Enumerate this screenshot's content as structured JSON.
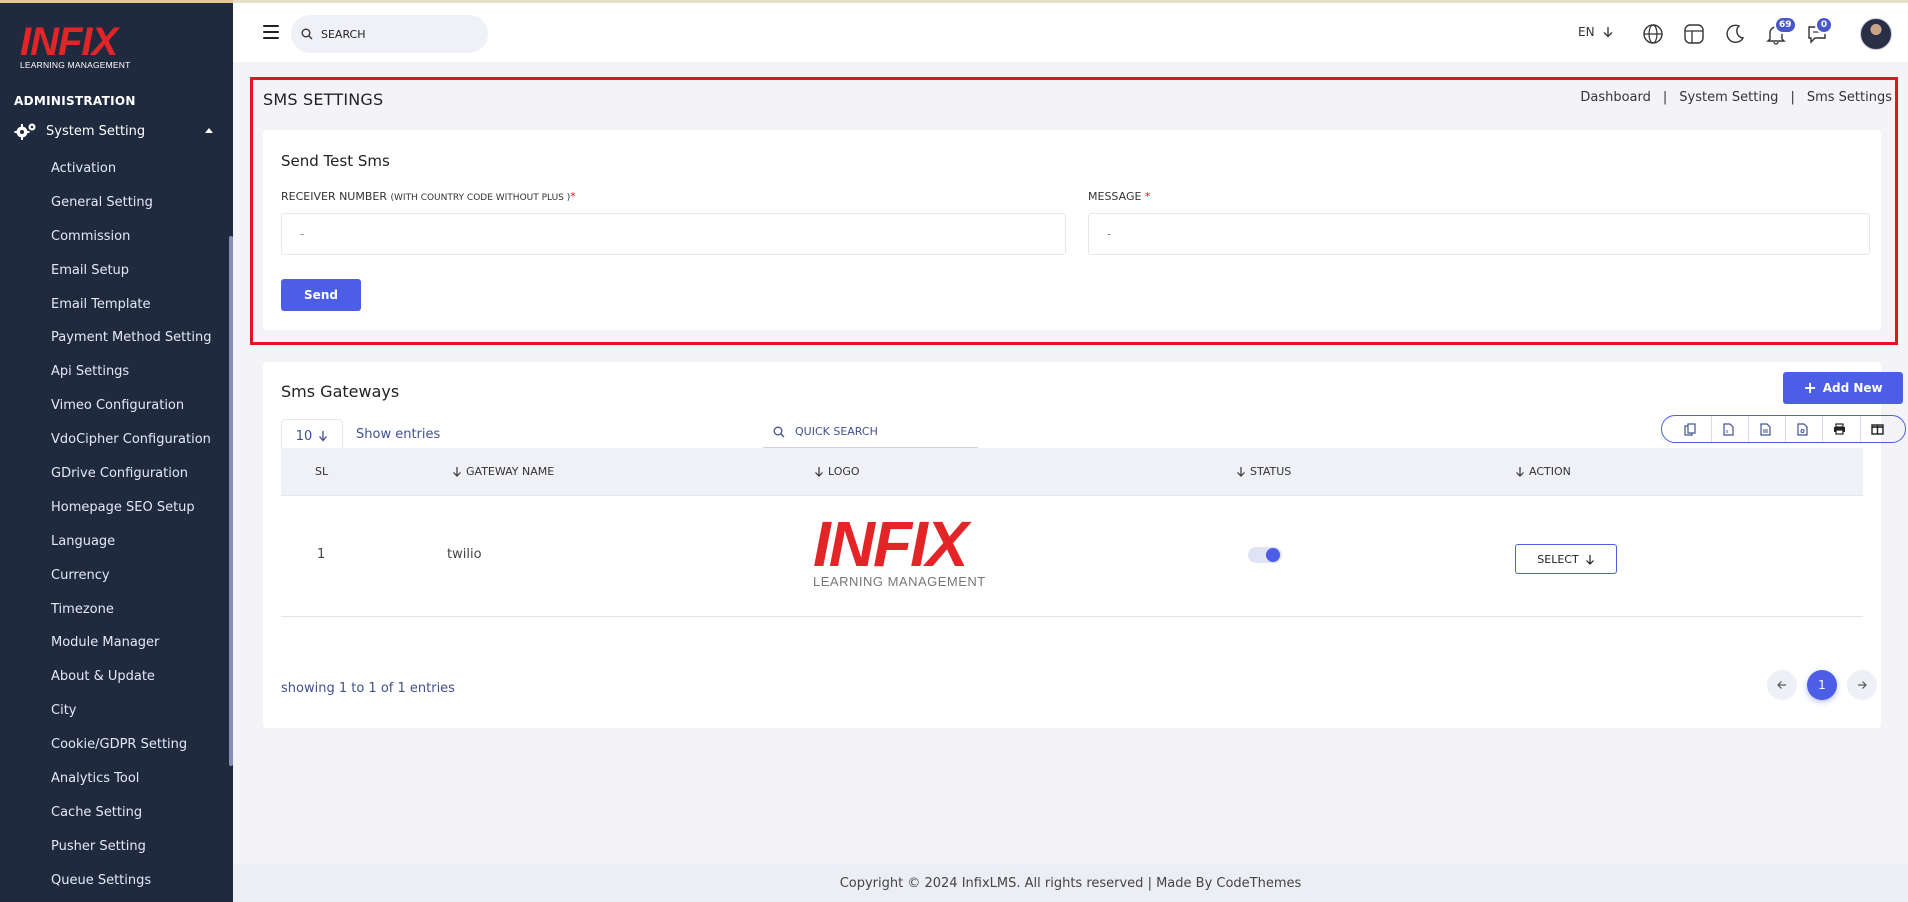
{
  "sidebar": {
    "logo": {
      "brand": "INFIX",
      "sub": "LEARNING MANAGEMENT"
    },
    "section_title": "ADMINISTRATION",
    "active_group": "System Setting",
    "items": [
      "Activation",
      "General Setting",
      "Commission",
      "Email Setup",
      "Email Template",
      "Payment Method Setting",
      "Api Settings",
      "Vimeo Configuration",
      "VdoCipher Configuration",
      "GDrive Configuration",
      "Homepage SEO Setup",
      "Language",
      "Currency",
      "Timezone",
      "Module Manager",
      "About & Update",
      "City",
      "Cookie/GDPR Setting",
      "Analytics Tool",
      "Cache Setting",
      "Pusher Setting",
      "Queue Settings"
    ]
  },
  "topbar": {
    "search_placeholder": "SEARCH",
    "language": "EN",
    "notifications_count": "69",
    "messages_count": "0"
  },
  "page": {
    "title": "SMS SETTINGS",
    "breadcrumb": [
      "Dashboard",
      "System Setting",
      "Sms Settings"
    ],
    "separator": "|"
  },
  "test_sms": {
    "title": "Send Test Sms",
    "receiver_label": "RECEIVER NUMBER",
    "receiver_hint": "(WITH COUNTRY CODE WITHOUT PLUS )",
    "receiver_placeholder": "-",
    "message_label": "MESSAGE",
    "message_placeholder": "-",
    "required_mark": "*",
    "send_label": "Send"
  },
  "gateways": {
    "title": "Sms Gateways",
    "add_new_label": "Add New",
    "entries_value": "10",
    "show_entries_label": "Show entries",
    "quick_search_placeholder": "QUICK SEARCH",
    "toolbar_icons": [
      "copy-icon",
      "csv-icon",
      "excel-icon",
      "pdf-icon",
      "print-icon",
      "columns-icon"
    ],
    "columns": [
      "SL",
      "GATEWAY NAME",
      "LOGO",
      "STATUS",
      "ACTION"
    ],
    "rows": [
      {
        "sl": "1",
        "name": "twilio",
        "logo_brand": "INFIX",
        "logo_sub": "LEARNING MANAGEMENT",
        "status_on": true,
        "action_label": "SELECT"
      }
    ],
    "showing_text": "showing 1 to 1 of 1 entries",
    "current_page": "1"
  },
  "footer": {
    "text": "Copyright © 2024 InfixLMS. All rights reserved | Made By CodeThemes"
  },
  "colors": {
    "accent": "#4d5ee6",
    "sidebar_bg": "#202a3f",
    "highlight_border": "#e3131f",
    "brand_red": "#e42528"
  }
}
